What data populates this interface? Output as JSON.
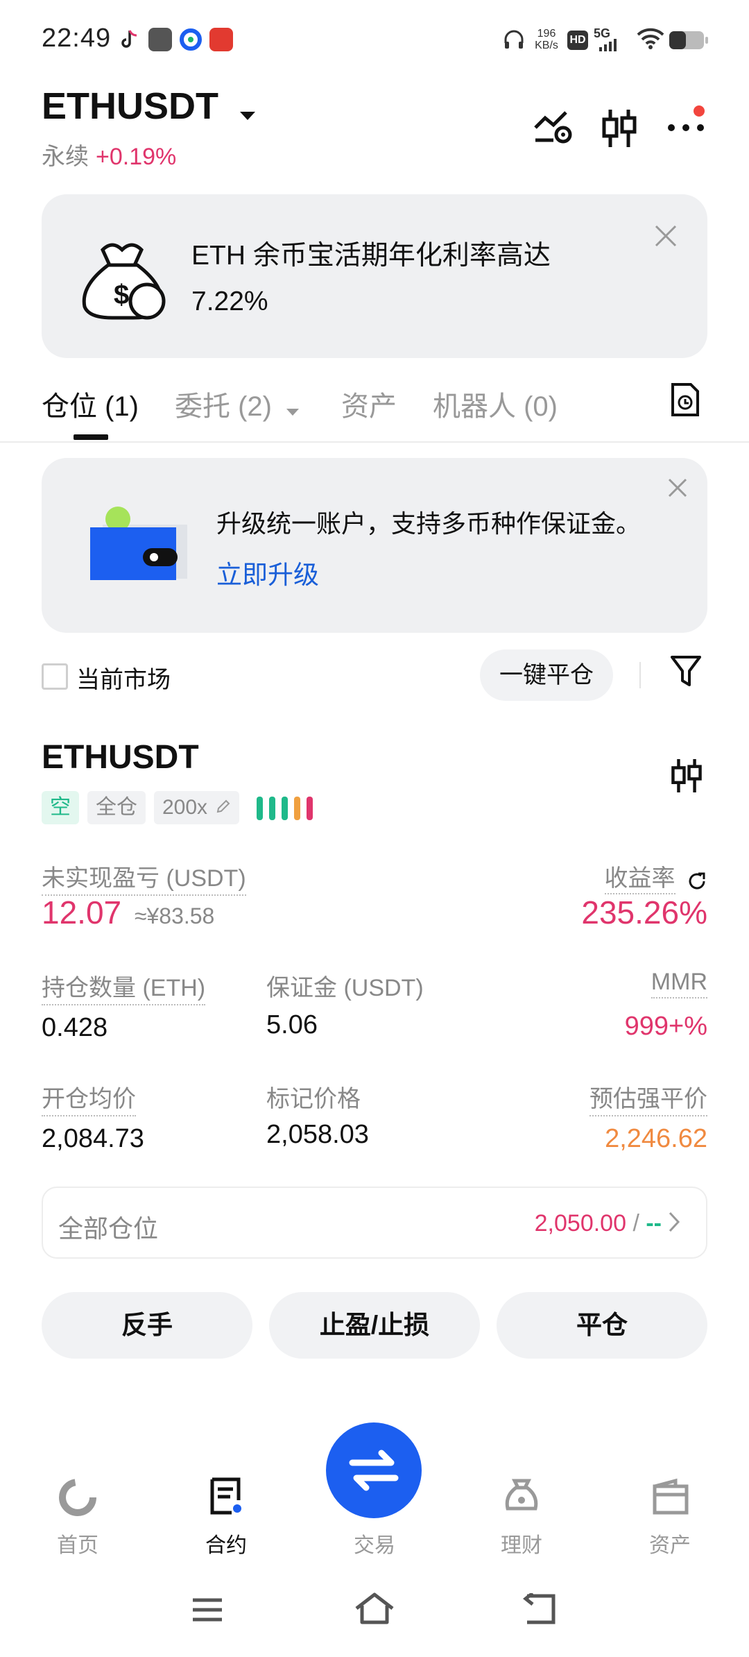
{
  "status_bar": {
    "time": "22:49",
    "net_speed_value": "196",
    "net_speed_unit": "KB/s",
    "hd": "HD",
    "signal": "5G"
  },
  "header": {
    "symbol": "ETHUSDT",
    "type": "永续",
    "change": "+0.19%"
  },
  "banner": {
    "line1": "ETH 余币宝活期年化利率高达",
    "line2": "7.22%"
  },
  "tabs": [
    {
      "label": "仓位 (1)"
    },
    {
      "label": "委托 (2)"
    },
    {
      "label": "资产"
    },
    {
      "label": "机器人 (0)"
    }
  ],
  "upgrade": {
    "text": "升级统一账户，支持多币种作保证金。",
    "link": "立即升级"
  },
  "filters": {
    "current_market": "当前市场",
    "close_all": "一键平仓"
  },
  "position": {
    "symbol": "ETHUSDT",
    "side": "空",
    "margin_mode": "全仓",
    "leverage": "200x",
    "risk_level": 5,
    "upl_label": "未实现盈亏 (USDT)",
    "upl_value": "12.07",
    "upl_cny": "≈¥83.58",
    "roi_label": "收益率",
    "roi_value": "235.26%",
    "qty_label": "持仓数量 (ETH)",
    "qty_value": "0.428",
    "margin_label": "保证金 (USDT)",
    "margin_value": "5.06",
    "mmr_label": "MMR",
    "mmr_value": "999+%",
    "entry_label": "开仓均价",
    "entry_value": "2,084.73",
    "mark_label": "标记价格",
    "mark_value": "2,058.03",
    "liq_label": "预估强平价",
    "liq_value": "2,246.62"
  },
  "all_positions": {
    "label": "全部仓位",
    "price": "2,050.00",
    "sep": " / ",
    "dash": "--"
  },
  "actions": {
    "reverse": "反手",
    "tpsl": "止盈/止损",
    "close": "平仓"
  },
  "nav": [
    {
      "label": "首页"
    },
    {
      "label": "合约"
    },
    {
      "label": "交易"
    },
    {
      "label": "理财"
    },
    {
      "label": "资产"
    }
  ],
  "colors": {
    "accent_blue": "#1c5ff0",
    "red": "#e0356c",
    "orange": "#f08a40",
    "green": "#1fb98a"
  }
}
